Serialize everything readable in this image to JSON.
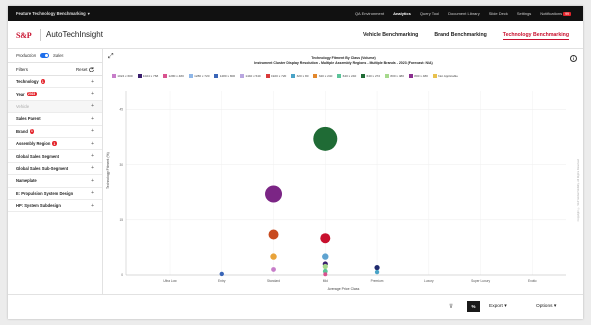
{
  "topbar": {
    "app_name": "Feature Technology Benchmarking",
    "chevron": "▾",
    "nav": [
      "QA Environment",
      "Analytics",
      "Query Tool",
      "Document Library",
      "Slide Deck",
      "Settings",
      "Notifications"
    ],
    "active_index": 1,
    "notification_count": "99"
  },
  "brand": {
    "logo": "S&P",
    "product": "AutoTechInsight",
    "nav": [
      "Vehicle Benchmarking",
      "Brand Benchmarking",
      "Technology Benchmarking"
    ],
    "active_index": 2
  },
  "sidebar": {
    "env_left": "Production",
    "env_right": "Sales",
    "filters_label": "Filters",
    "reset_label": "Reset",
    "items": [
      {
        "label": "Technology",
        "badge": "1",
        "disabled": false
      },
      {
        "label": "Year",
        "badge": "2023",
        "disabled": false
      },
      {
        "label": "Vehicle",
        "badge": "",
        "disabled": true
      },
      {
        "label": "Sales Parent",
        "badge": "",
        "disabled": false
      },
      {
        "label": "Brand",
        "badge": "1",
        "disabled": false
      },
      {
        "label": "Assembly Region",
        "badge": "1",
        "disabled": false
      },
      {
        "label": "Global Sales Segment",
        "badge": "",
        "disabled": false
      },
      {
        "label": "Global Sales Sub-Segment",
        "badge": "",
        "disabled": false
      },
      {
        "label": "Nameplate",
        "badge": "",
        "disabled": false
      },
      {
        "label": "E: Propulsion System Design",
        "badge": "",
        "disabled": false
      },
      {
        "label": "HP: System Subdesign",
        "badge": "",
        "disabled": false
      }
    ],
    "plus": "+"
  },
  "chart_data": {
    "type": "scatter",
    "title_line1": "Technology Fitment By Class (Volume)",
    "title_line2": "Instrument Cluster Display Resolution - Multiple Assembly Regions - Multiple Brands - 2023 (Forecast: N/A)",
    "ylabel": "Technology Fitment (%)",
    "xlabel": "Average Price Class",
    "categories": [
      "Ultra Low",
      "Entry",
      "Standard",
      "Mid",
      "Premium",
      "Luxury",
      "Super Luxury",
      "Exotic"
    ],
    "ylim": [
      0,
      50
    ],
    "yticks": [
      0,
      15,
      30,
      45
    ],
    "grid": true,
    "legend_position": "top",
    "legend": [
      {
        "name": "1024 x 600",
        "color": "#c77dc9"
      },
      {
        "name": "1024 x 768",
        "color": "#3b1f6e"
      },
      {
        "name": "1280 x 480",
        "color": "#d9528f"
      },
      {
        "name": "1280 x 720",
        "color": "#8fb7e8"
      },
      {
        "name": "1280 x 800",
        "color": "#3a66b8"
      },
      {
        "name": "1440 x 540",
        "color": "#b9a6e0"
      },
      {
        "name": "1920 x 720",
        "color": "#d93a3a"
      },
      {
        "name": "320 x 80",
        "color": "#4aa3c7"
      },
      {
        "name": "320 x 240",
        "color": "#e2872c"
      },
      {
        "name": "640 x 240",
        "color": "#5cc49a"
      },
      {
        "name": "640 x 272",
        "color": "#1f6b35"
      },
      {
        "name": "800 x 480",
        "color": "#a6d98c"
      },
      {
        "name": "800 x 480",
        "color": "#8b2f8f"
      },
      {
        "name": "Not Applicable",
        "color": "#e8c14d"
      }
    ],
    "points": [
      {
        "category": "Mid",
        "y": 37,
        "size": 12,
        "color": "#1f6b35"
      },
      {
        "category": "Standard",
        "y": 22,
        "size": 8.5,
        "color": "#7b2585"
      },
      {
        "category": "Standard",
        "y": 11,
        "size": 5,
        "color": "#c84a1f"
      },
      {
        "category": "Mid",
        "y": 10,
        "size": 5,
        "color": "#c8102e"
      },
      {
        "category": "Standard",
        "y": 5,
        "size": 3.2,
        "color": "#e8a33a"
      },
      {
        "category": "Mid",
        "y": 5,
        "size": 3.2,
        "color": "#5fa3d0"
      },
      {
        "category": "Mid",
        "y": 3,
        "size": 2.6,
        "color": "#3b1f6e"
      },
      {
        "category": "Mid",
        "y": 2.3,
        "size": 2.6,
        "color": "#a6d98c"
      },
      {
        "category": "Mid",
        "y": 1,
        "size": 2.4,
        "color": "#5cc49a"
      },
      {
        "category": "Premium",
        "y": 2,
        "size": 2.6,
        "color": "#1f2a6e"
      },
      {
        "category": "Premium",
        "y": 0.8,
        "size": 2.2,
        "color": "#4aa3c7"
      },
      {
        "category": "Standard",
        "y": 1.5,
        "size": 2.4,
        "color": "#c77dc9"
      },
      {
        "category": "Entry",
        "y": 0.3,
        "size": 2.2,
        "color": "#3a66b8"
      },
      {
        "category": "Mid",
        "y": 0.2,
        "size": 2,
        "color": "#d9528f"
      }
    ]
  },
  "footer": {
    "percent_label": "%",
    "export_label": "Export",
    "options_label": "Options",
    "caret": "▾"
  },
  "copyright": "Copyright © S&P Global Mobility. All Rights Reserved"
}
